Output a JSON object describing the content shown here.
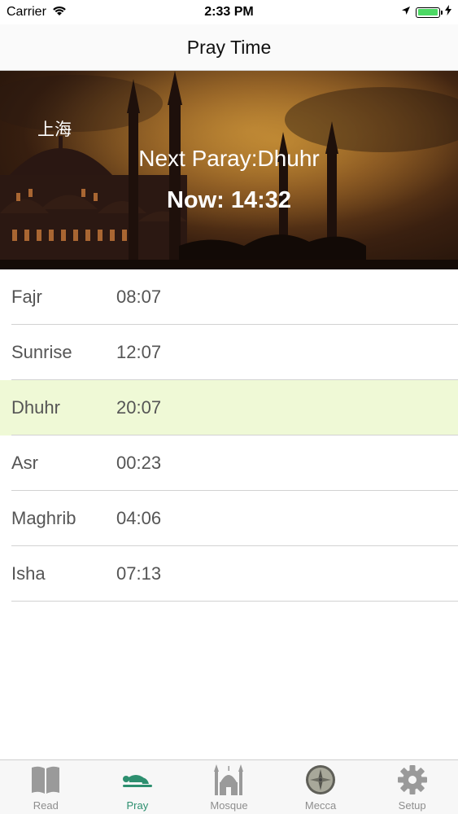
{
  "status_bar": {
    "carrier": "Carrier",
    "time": "2:33 PM"
  },
  "nav": {
    "title": "Pray Time"
  },
  "hero": {
    "city": "上海",
    "next_prayer": "Next Paray:Dhuhr",
    "now": "Now: 14:32"
  },
  "prayers": [
    {
      "name": "Fajr",
      "time": "08:07",
      "current": false
    },
    {
      "name": "Sunrise",
      "time": "12:07",
      "current": false
    },
    {
      "name": "Dhuhr",
      "time": "20:07",
      "current": true
    },
    {
      "name": "Asr",
      "time": "00:23",
      "current": false
    },
    {
      "name": "Maghrib",
      "time": "04:06",
      "current": false
    },
    {
      "name": "Isha",
      "time": "07:13",
      "current": false
    }
  ],
  "tabs": [
    {
      "label": "Read",
      "icon": "book-icon",
      "active": false
    },
    {
      "label": "Pray",
      "icon": "praying-person-icon",
      "active": true
    },
    {
      "label": "Mosque",
      "icon": "mosque-icon",
      "active": false
    },
    {
      "label": "Mecca",
      "icon": "compass-icon",
      "active": false
    },
    {
      "label": "Setup",
      "icon": "gear-icon",
      "active": false
    }
  ],
  "colors": {
    "current_row_bg": "#eff9d6",
    "active_tab": "#2d8f6f",
    "inactive_tab": "#8e8e8e",
    "battery": "#4cd964"
  }
}
